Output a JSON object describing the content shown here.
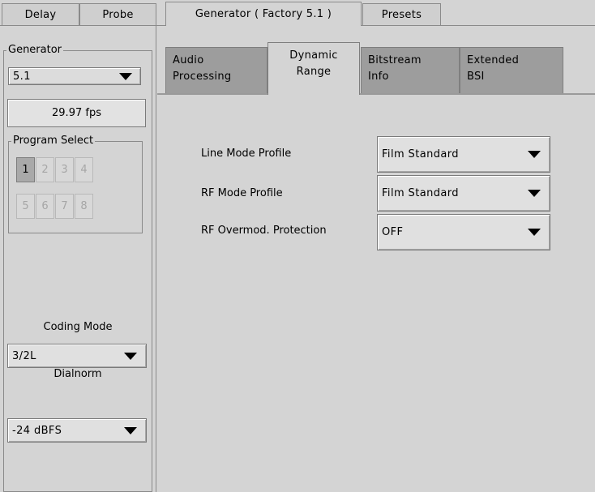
{
  "top_tabs": {
    "delay": "Delay",
    "probe": "Probe",
    "generator": "Generator ( Factory 5.1 )",
    "presets": "Presets"
  },
  "left": {
    "generator_group_label": "Generator",
    "generator_select": "5.1",
    "fps": "29.97 fps",
    "program_select_label": "Program Select",
    "programs": [
      "1",
      "2",
      "3",
      "4",
      "5",
      "6",
      "7",
      "8"
    ],
    "active_program": "1",
    "coding_mode_label": "Coding Mode",
    "coding_mode_value": "3/2L",
    "dialnorm_label": "Dialnorm",
    "dialnorm_value": "-24 dBFS"
  },
  "sub_tabs": [
    {
      "line1": "Audio",
      "line2": "Processing"
    },
    {
      "line1": "Dynamic",
      "line2": "Range"
    },
    {
      "line1": "Bitstream",
      "line2": "Info"
    },
    {
      "line1": "Extended",
      "line2": "BSI"
    }
  ],
  "form": {
    "line_mode_label": "Line Mode Profile",
    "line_mode_value": "Film Standard",
    "rf_mode_label": "RF Mode Profile",
    "rf_mode_value": "Film Standard",
    "rf_overmod_label": "RF Overmod. Protection",
    "rf_overmod_value": "OFF"
  }
}
